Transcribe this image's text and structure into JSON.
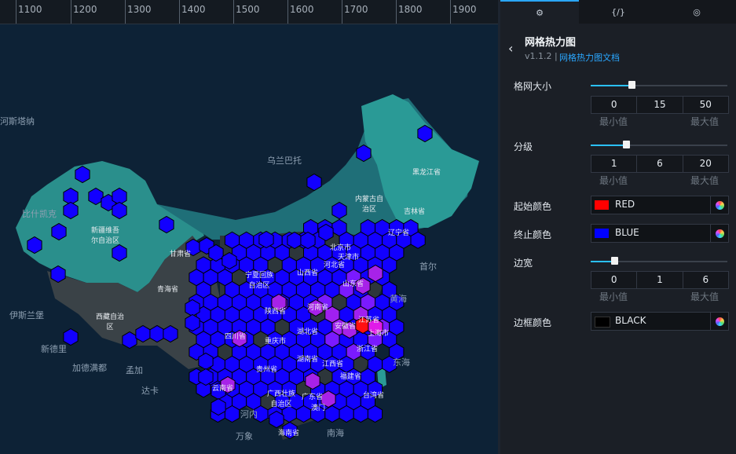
{
  "ruler": {
    "labels": [
      "1100",
      "1200",
      "1300",
      "1400",
      "1500",
      "1600",
      "1700",
      "1800",
      "1900"
    ]
  },
  "map": {
    "place_labels": [
      {
        "name": "哈萨克斯坦 fragment",
        "text": "河斯塔纳",
        "dim": true
      },
      {
        "name": "mongolia",
        "text": "乌兰巴托",
        "dim": true
      },
      {
        "name": "kyrgyz",
        "text": "比什凯克",
        "dim": true
      },
      {
        "name": "xinjiang",
        "text": "新疆维吾\n尔自治区",
        "dim": false
      },
      {
        "name": "gansu",
        "text": "甘肃省",
        "dim": false
      },
      {
        "name": "qinghai",
        "text": "青海省",
        "dim": false
      },
      {
        "name": "tibet",
        "text": "西藏自治\n区",
        "dim": false
      },
      {
        "name": "islamabad",
        "text": "伊斯兰堡",
        "dim": true
      },
      {
        "name": "delhi",
        "text": "新德里",
        "dim": true
      },
      {
        "name": "kathmandu",
        "text": "加德满都",
        "dim": true
      },
      {
        "name": "dhaka",
        "text": "达卡",
        "dim": true
      },
      {
        "name": "neimenggu",
        "text": "内蒙古自\n治区",
        "dim": false
      },
      {
        "name": "heilongjiang",
        "text": "黑龙江省",
        "dim": false
      },
      {
        "name": "jilin",
        "text": "吉林省",
        "dim": false
      },
      {
        "name": "liaoning",
        "text": "辽宁省",
        "dim": false
      },
      {
        "name": "beijing",
        "text": "北京市",
        "dim": false
      },
      {
        "name": "tianjin",
        "text": "天津市",
        "dim": false
      },
      {
        "name": "hebei",
        "text": "河北省",
        "dim": false
      },
      {
        "name": "ningxia",
        "text": "宁夏回族\n自治区",
        "dim": false
      },
      {
        "name": "shanxi",
        "text": "山西省",
        "dim": false
      },
      {
        "name": "shandong",
        "text": "山东省",
        "dim": false
      },
      {
        "name": "shaanxi",
        "text": "陕西省",
        "dim": false
      },
      {
        "name": "henan",
        "text": "河南省",
        "dim": false
      },
      {
        "name": "sichuan",
        "text": "四川省",
        "dim": false
      },
      {
        "name": "chongqing",
        "text": "重庆市",
        "dim": false
      },
      {
        "name": "hubei",
        "text": "湖北省",
        "dim": false
      },
      {
        "name": "anhui",
        "text": "安徽省",
        "dim": false
      },
      {
        "name": "jiangsu",
        "text": "江苏省",
        "dim": false
      },
      {
        "name": "shanghai",
        "text": "上海市",
        "dim": false
      },
      {
        "name": "zhejiang",
        "text": "浙江省",
        "dim": false
      },
      {
        "name": "hunan",
        "text": "湖南省",
        "dim": false
      },
      {
        "name": "jiangxi",
        "text": "江西省",
        "dim": false
      },
      {
        "name": "guizhou",
        "text": "贵州省",
        "dim": false
      },
      {
        "name": "fujian",
        "text": "福建省",
        "dim": false
      },
      {
        "name": "yunnan",
        "text": "云南省",
        "dim": false
      },
      {
        "name": "guangxi",
        "text": "广西壮族\n自治区",
        "dim": false
      },
      {
        "name": "guangdong",
        "text": "广东省",
        "dim": false
      },
      {
        "name": "aomen",
        "text": "澳门",
        "dim": false
      },
      {
        "name": "taiwan",
        "text": "台湾省",
        "dim": false
      },
      {
        "name": "hainan",
        "text": "海南省",
        "dim": false
      },
      {
        "name": "seoul",
        "text": "首尔",
        "dim": true
      },
      {
        "name": "huanghai",
        "text": "黄海",
        "dim": true
      },
      {
        "name": "donghai",
        "text": "东海",
        "dim": true
      },
      {
        "name": "nanhai",
        "text": "南海",
        "dim": true
      },
      {
        "name": "hanoi",
        "text": "河内",
        "dim": true
      },
      {
        "name": "wanxiang",
        "text": "万象",
        "dim": true
      },
      {
        "name": "rongbo",
        "text": "孟加",
        "dim": true
      }
    ]
  },
  "panel": {
    "tabs": [
      "⚙",
      "{/}",
      "◎"
    ],
    "back": "‹",
    "title": "网格热力图",
    "version": "v1.1.2 |",
    "doc_link": "网格热力图文档",
    "grid_size": {
      "label": "格网大小",
      "min": "0",
      "value": "15",
      "max": "50",
      "level": 0.3,
      "min_label": "最小值",
      "max_label": "最大值"
    },
    "levels": {
      "label": "分级",
      "min": "1",
      "value": "6",
      "max": "20",
      "level": 0.26,
      "min_label": "最小值",
      "max_label": "最大值"
    },
    "start_color": {
      "label": "起始颜色",
      "value": "RED",
      "color": "#ff0000"
    },
    "end_color": {
      "label": "终止颜色",
      "value": "BLUE",
      "color": "#0000ff"
    },
    "border_width": {
      "label": "边宽",
      "min": "0",
      "value": "1",
      "max": "6",
      "level": 0.17,
      "min_label": "最小值",
      "max_label": "最大值"
    },
    "border_color": {
      "label": "边框颜色",
      "value": "BLACK",
      "color": "#000000"
    }
  }
}
